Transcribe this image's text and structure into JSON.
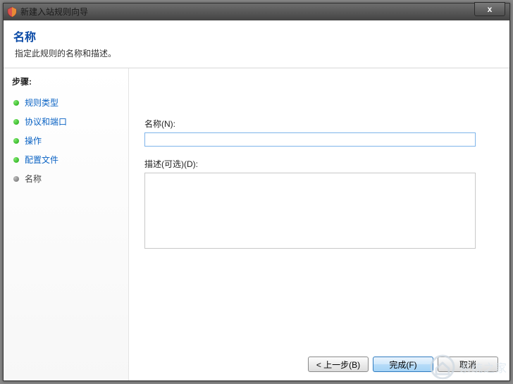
{
  "window": {
    "title": "新建入站规则向导",
    "close_label": "x"
  },
  "header": {
    "title": "名称",
    "subtitle": "指定此规则的名称和描述。"
  },
  "sidebar": {
    "steps_label": "步骤:",
    "items": [
      {
        "label": "规则类型",
        "state": "completed"
      },
      {
        "label": "协议和端口",
        "state": "completed"
      },
      {
        "label": "操作",
        "state": "completed"
      },
      {
        "label": "配置文件",
        "state": "completed"
      },
      {
        "label": "名称",
        "state": "current"
      }
    ]
  },
  "form": {
    "name_label": "名称(N):",
    "name_value": "",
    "desc_label": "描述(可选)(D):",
    "desc_value": ""
  },
  "buttons": {
    "back": "< 上一步(B)",
    "finish": "完成(F)",
    "cancel": "取消"
  },
  "watermark": {
    "text": "系统之家"
  }
}
